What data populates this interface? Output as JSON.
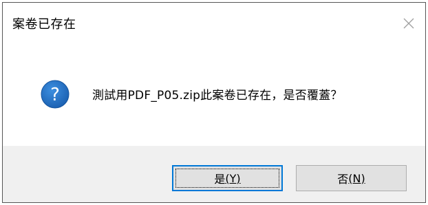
{
  "dialog": {
    "title": "案卷已存在",
    "message": "測試用PDF_P05.zip此案卷已存在，是否覆蓋？",
    "icon": "question-icon",
    "buttons": {
      "yes": {
        "label": "是",
        "accelerator": "(Y)"
      },
      "no": {
        "label": "否",
        "accelerator": "(N)"
      }
    },
    "colors": {
      "icon_blue": "#1e6fc4",
      "default_button_border": "#0078d7",
      "footer_background": "#f0f0f0",
      "button_background": "#e1e1e1"
    }
  }
}
